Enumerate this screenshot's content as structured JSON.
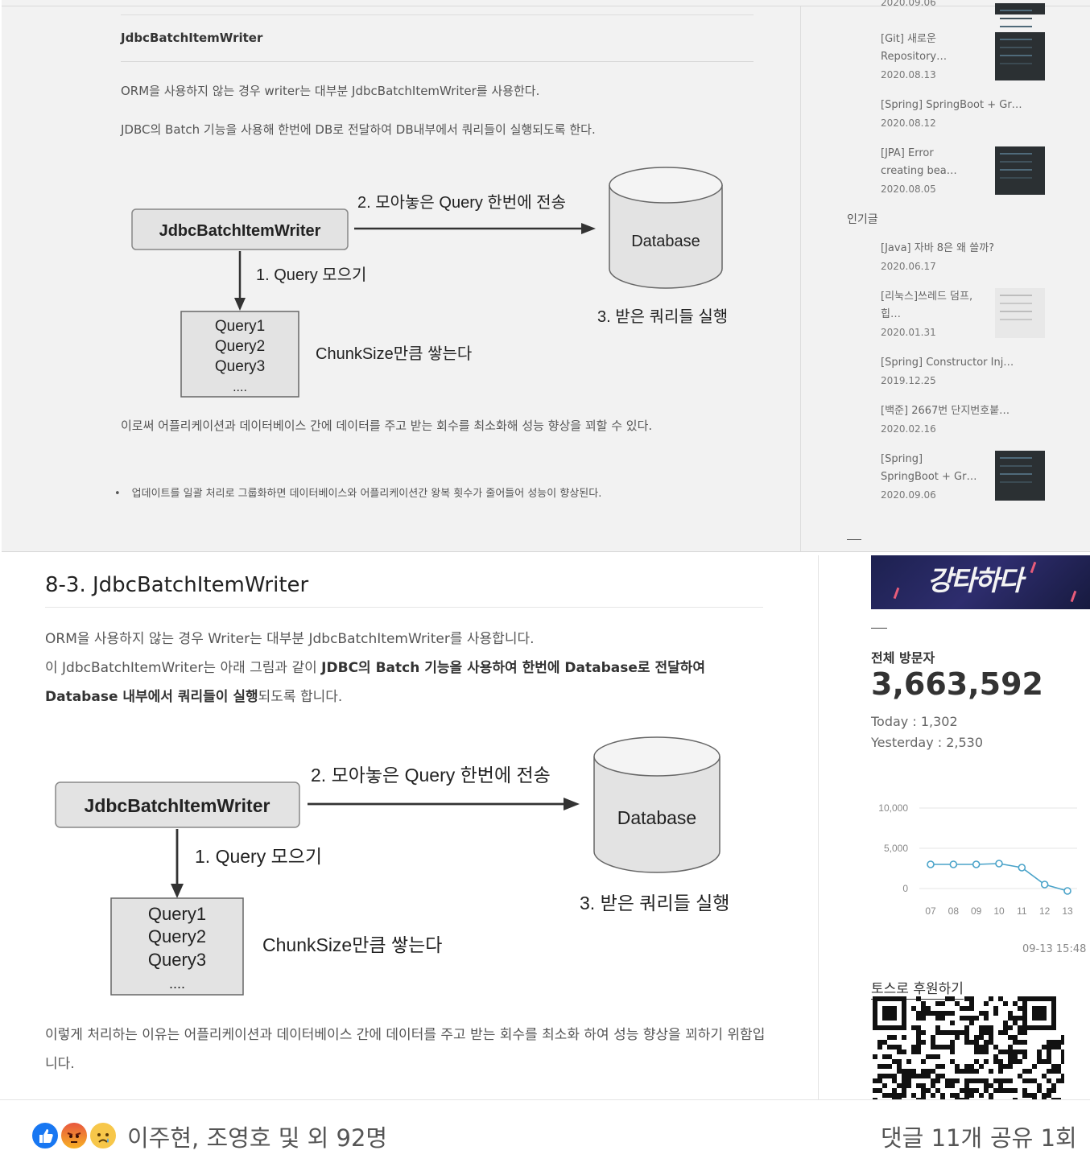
{
  "top": {
    "title": "JdbcBatchItemWriter",
    "para1": "ORM을 사용하지 않는 경우 writer는 대부분 JdbcBatchItemWriter를 사용한다.",
    "para2": "JDBC의 Batch 기능을 사용해 한번에 DB로 전달하여 DB내부에서 쿼리들이 실행되도록 한다.",
    "para3": "이로써 어플리케이션과 데이터베이스 간에 데이터를 주고 받는 회수를 최소화해 성능 향상을 꾀할 수 있다.",
    "bullet": "업데이트를 일괄 처리로 그룹화하면 데이터베이스와 어플리케이션간 왕복 횟수가 줄어들어 성능이 향상된다.",
    "sidebar": {
      "cut_date": "2020.09.06",
      "recent": [
        {
          "title": "[Git] 새로운\nRepository…",
          "date": "2020.08.13"
        },
        {
          "title": "[Spring] SpringBoot + Gr…",
          "date": "2020.08.12"
        },
        {
          "title": "[JPA] Error\ncreating bea…",
          "date": "2020.08.05"
        }
      ],
      "popular_heading": "인기글",
      "popular": [
        {
          "title": "[Java] 자바 8은 왜 쓸까?",
          "date": "2020.06.17"
        },
        {
          "title": "[리눅스]쓰레드 덤프,\n힙…",
          "date": "2020.01.31"
        },
        {
          "title": "[Spring] Constructor Inj…",
          "date": "2019.12.25"
        },
        {
          "title": "[백준] 2667번 단지번호붙…",
          "date": "2020.02.16"
        },
        {
          "title": "[Spring]\nSpringBoot + Gr…",
          "date": "2020.09.06"
        }
      ]
    }
  },
  "diagram": {
    "writer": "JdbcBatchItemWriter",
    "step1": "1. Query 모으기",
    "step2": "2. 모아놓은 Query 한번에 전송",
    "step3": "3. 받은 쿼리들 실행",
    "db": "Database",
    "queries": [
      "Query1",
      "Query2",
      "Query3",
      "...."
    ],
    "chunk": "ChunkSize만큼 쌓는다"
  },
  "bottom": {
    "title": "8-3. JdbcBatchItemWriter",
    "para1": "ORM을 사용하지 않는 경우 Writer는 대부분 JdbcBatchItemWriter를 사용합니다.",
    "para2_a": "이 JdbcBatchItemWriter는 아래 그림과 같이 ",
    "para2_b": "JDBC의 Batch 기능을 사용하여 한번에 Database로 전달하여 Database 내부에서 쿼리들이 실행",
    "para2_c": "되도록 합니다.",
    "para3": "이렇게 처리하는 이유는 어플리케이션과 데이터베이스 간에 데이터를 주고 받는 회수를 최소화 하여 성능 향상을 꾀하기 위함입니다.",
    "banner_text": "강타하다",
    "visitors_label": "전체 방문자",
    "visitors_total": "3,663,592",
    "today": "Today : 1,302",
    "yesterday": "Yesterday : 2,530",
    "chart_timestamp": "09-13 15:48",
    "toss_label": "토스로 후원하기"
  },
  "chart_data": {
    "type": "line",
    "categories": [
      "07",
      "08",
      "09",
      "10",
      "11",
      "12",
      "13"
    ],
    "values": [
      3000,
      3000,
      3000,
      3100,
      2600,
      500,
      -300
    ],
    "yticks": [
      "10,000",
      "5,000",
      "0"
    ],
    "ylim": [
      0,
      10000
    ],
    "color": "#4aa3c9"
  },
  "reactions": {
    "names": "이주현, 조영호 및 외 92명",
    "comments": "댓글 11개",
    "shares": "공유 1회"
  }
}
